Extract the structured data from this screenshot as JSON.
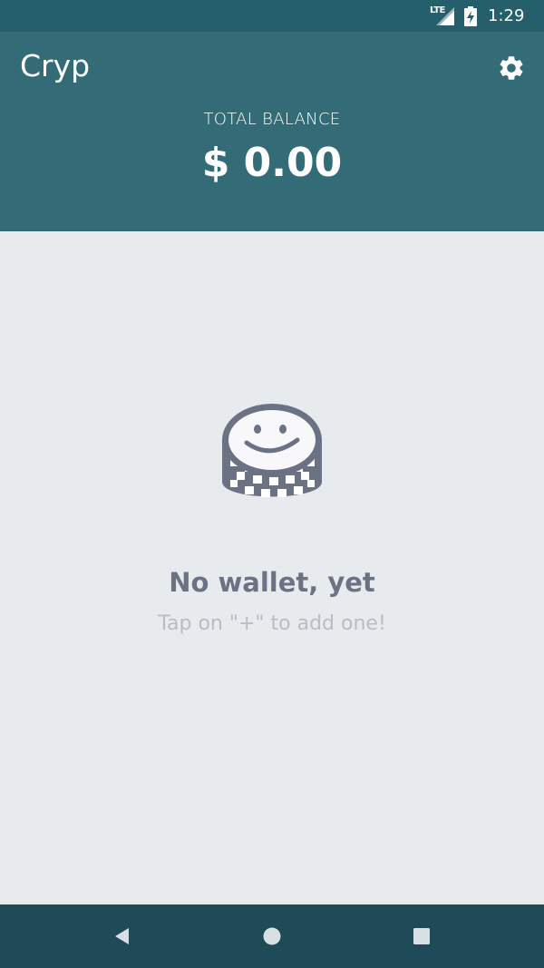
{
  "status_bar": {
    "network": "LTE",
    "time": "1:29",
    "icons": [
      "signal-icon",
      "battery-charging-icon"
    ]
  },
  "header": {
    "app_title": "Cryp",
    "settings_icon": "gear-icon",
    "balance_label": "TOTAL BALANCE",
    "balance_value": "$ 0.00"
  },
  "empty_state": {
    "icon": "coin-stack-smiley-icon",
    "title": "No wallet, yet",
    "hint": "Tap on \"+\" to add one!"
  },
  "nav_bar": {
    "icons": [
      "back-icon",
      "home-icon",
      "recents-icon"
    ]
  },
  "colors": {
    "status_bar": "#245f6b",
    "header": "#336c77",
    "background": "#e8ebee",
    "nav_bar": "#1f4b58",
    "empty_title": "#6a7284",
    "empty_hint": "#b8bcc4"
  }
}
